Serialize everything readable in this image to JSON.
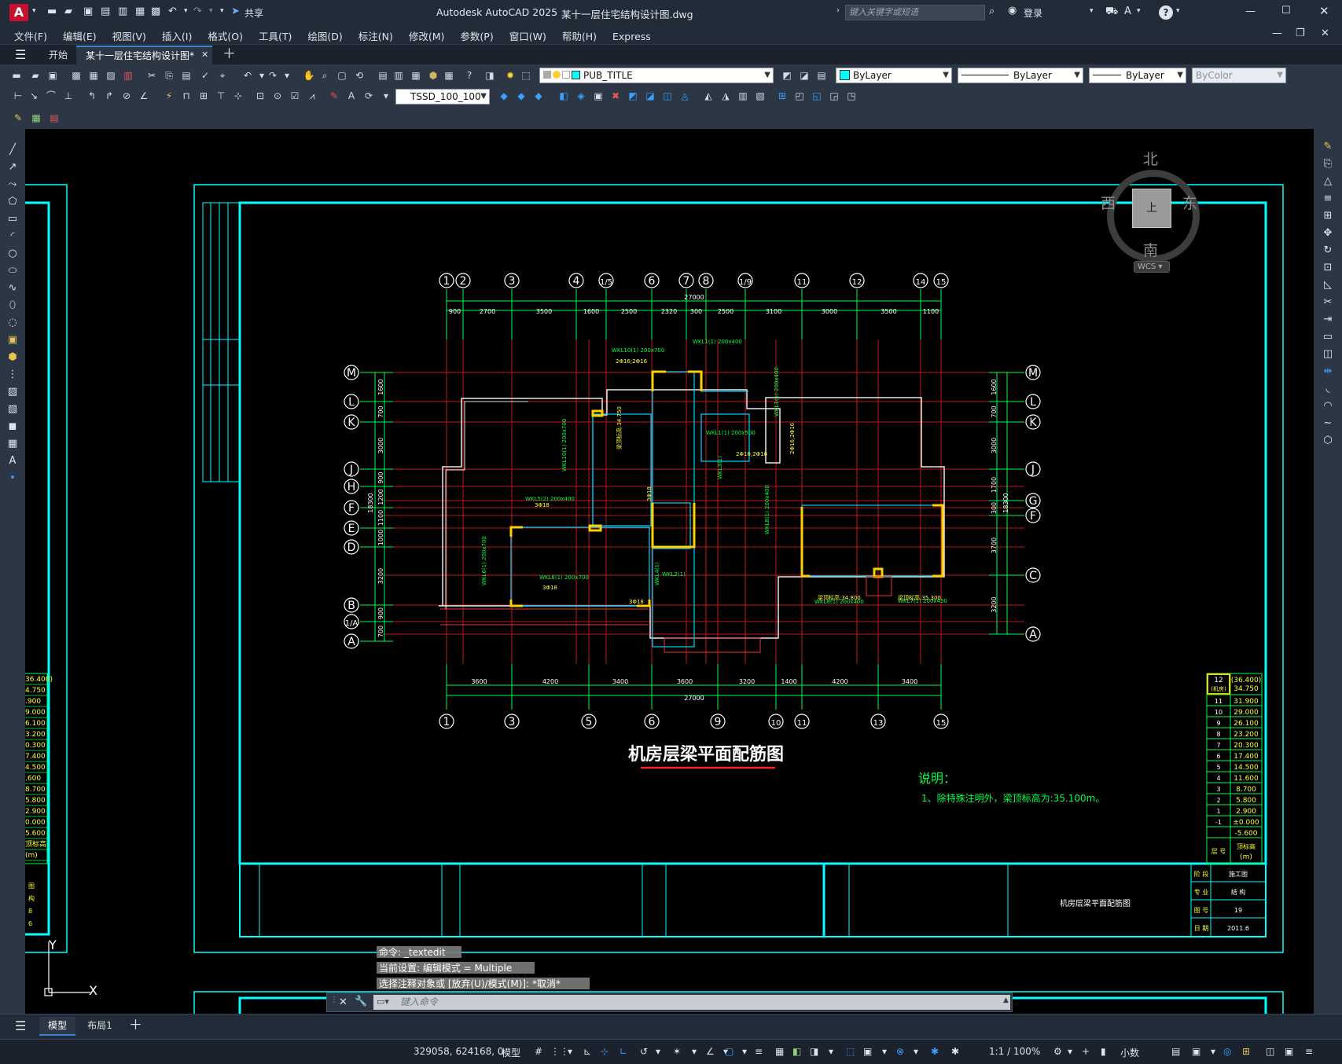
{
  "app": {
    "title": "Autodesk AutoCAD 2025",
    "file": "某十一层住宅结构设计图.dwg",
    "search_placeholder": "键入关键字或短语",
    "login": "登录",
    "share": "共享",
    "logo": "A"
  },
  "menu": [
    "文件(F)",
    "编辑(E)",
    "视图(V)",
    "插入(I)",
    "格式(O)",
    "工具(T)",
    "绘图(D)",
    "标注(N)",
    "修改(M)",
    "参数(P)",
    "窗口(W)",
    "帮助(H)",
    "Express"
  ],
  "tabs": {
    "start": "开始",
    "doc": "某十一层住宅结构设计图*"
  },
  "toolbar": {
    "layer": "PUB_TITLE",
    "color": "ByLayer",
    "linetype": "ByLayer",
    "lineweight": "ByLayer",
    "plotstyle": "ByColor",
    "dimstyle": "TSSD_100_100"
  },
  "viewcube": {
    "north": "北",
    "south": "南",
    "east": "东",
    "west": "西",
    "top": "上",
    "wcs": "WCS"
  },
  "drawing": {
    "title": "机房层梁平面配筋图",
    "notes_title": "说明：",
    "note1": "1、除特殊注明外，梁顶标高为:35.100m。",
    "titleblock_name": "机房层梁平面配筋图",
    "overall_dim": "27000",
    "top_axes": [
      "1",
      "2",
      "3",
      "4",
      "1/5",
      "6",
      "7",
      "8",
      "1/9",
      "11",
      "12",
      "14",
      "15"
    ],
    "bottom_axes": [
      "1",
      "3",
      "5",
      "6",
      "9",
      "10",
      "11",
      "13",
      "15"
    ],
    "left_axes": [
      "M",
      "L",
      "K",
      "J",
      "H",
      "F",
      "E",
      "D",
      "B",
      "1/A",
      "A"
    ],
    "right_axes": [
      "M",
      "L",
      "K",
      "J",
      "G",
      "F",
      "C",
      "A"
    ],
    "top_dims": [
      "900",
      "2700",
      "3500",
      "1600",
      "2500",
      "2320",
      "300",
      "2500",
      "3100",
      "3000",
      "3500",
      "1100"
    ],
    "bottom_dims": [
      "3600",
      "4200",
      "3400",
      "3600",
      "3200",
      "1400",
      "4200",
      "3400"
    ],
    "left_dims": [
      "1600",
      "700",
      "3000",
      "900",
      "1200",
      "1100",
      "1000",
      "3200",
      "900",
      "700"
    ],
    "right_dims": [
      "1600",
      "700",
      "3000",
      "1700",
      "300",
      "3700",
      "3200"
    ],
    "left_total": "18300",
    "right_total": "18300",
    "beam_labels": [
      "WKL10(1) 200x700",
      "WKL1(1) 200x400",
      "WKL1(1) 200x500",
      "WKL5(2) 200x400",
      "WKL6(1) 200x700",
      "WKL8(1) 200x400",
      "WKL7(1) 200x450",
      "WKL4(1)",
      "WKL3(1)",
      "WKL2(1)",
      "梁顶标高:34.750",
      "梁顶标高:35.400",
      "梁顶标高:34.800",
      "梁顶标高:35.300",
      "2Φ16;2Φ16",
      "3Φ18"
    ],
    "floor_table": {
      "rows": [
        [
          "12\n(机房)",
          "(36.400)\n34.750"
        ],
        [
          "11",
          "31.900"
        ],
        [
          "10",
          "29.000"
        ],
        [
          "9",
          "26.100"
        ],
        [
          "8",
          "23.200"
        ],
        [
          "7",
          "20.300"
        ],
        [
          "6",
          "17.400"
        ],
        [
          "5",
          "14.500"
        ],
        [
          "4",
          "11.600"
        ],
        [
          "3",
          "8.700"
        ],
        [
          "2",
          "5.800"
        ],
        [
          "1",
          "2.900"
        ],
        [
          "-1",
          "±0.000"
        ],
        [
          "",
          "-5.600"
        ]
      ],
      "footer": [
        "层 号",
        "顶标高\n(m)"
      ]
    },
    "left_partial_values": [
      "36.400)",
      "4.750",
      ".900",
      "9.000",
      "6.100",
      "3.200",
      "0.300",
      "7.400",
      "4.500",
      ".600",
      "8.700",
      "5.800",
      "2.900",
      "0.000",
      "5.600",
      "顶标高",
      "(m)"
    ],
    "left_partial_tb": [
      "图",
      "构",
      "8",
      "6"
    ],
    "tb_labels": [
      "阶 段",
      "专 业",
      "图 号",
      "日 期"
    ],
    "tb_values": [
      "施工图",
      "结 构",
      "19",
      "2011.6"
    ],
    "ucs_y": "Y",
    "ucs_x": "X"
  },
  "command": {
    "history": [
      "命令: _textedit",
      "当前设置: 编辑模式 = Multiple",
      "选择注释对象或 [放弃(U)/模式(M)]: *取消*"
    ],
    "placeholder": "键入命令"
  },
  "layouts": [
    "模型",
    "布局1"
  ],
  "status": {
    "coords": "329058, 624168, 0",
    "mode": "模型",
    "scale": "1:1 / 100%",
    "units": "小数"
  }
}
